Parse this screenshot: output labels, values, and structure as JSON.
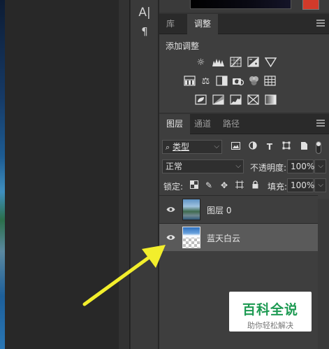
{
  "tools": {
    "type_icon_label": "A|",
    "paragraph_icon_label": "¶"
  },
  "adjust_panel": {
    "tabs": [
      "库",
      "调整"
    ],
    "active_tab": 1,
    "title": "添加调整",
    "icons_row1": [
      "brightness-icon",
      "levels-icon",
      "curves-icon",
      "exposure-icon",
      "vibrance-icon"
    ],
    "icons_row2": [
      "hue-saturation-icon",
      "color-balance-icon",
      "black-white-icon",
      "photo-filter-icon",
      "channel-mixer-icon",
      "color-lookup-icon"
    ],
    "icons_row3": [
      "invert-icon",
      "posterize-icon",
      "threshold-icon",
      "selective-color-icon",
      "gradient-map-icon"
    ]
  },
  "layers_panel": {
    "tabs": [
      "图层",
      "通道",
      "路径"
    ],
    "active_tab": 0,
    "filter_value": "类型",
    "blend_mode": "正常",
    "opacity_label": "不透明度:",
    "opacity_value": "100%",
    "lock_label": "锁定:",
    "fill_label": "填充:",
    "fill_value": "100%",
    "layers": [
      {
        "name": "图层 0",
        "visible": true,
        "selected": false
      },
      {
        "name": "蓝天白云",
        "visible": true,
        "selected": true
      }
    ]
  },
  "watermark": {
    "title": "百科全说",
    "subtitle": "助你轻松解决"
  },
  "colors": {
    "arrow": "#f2ee2c",
    "accent_green": "#1d9a52",
    "swatch": "#d23a2a"
  }
}
